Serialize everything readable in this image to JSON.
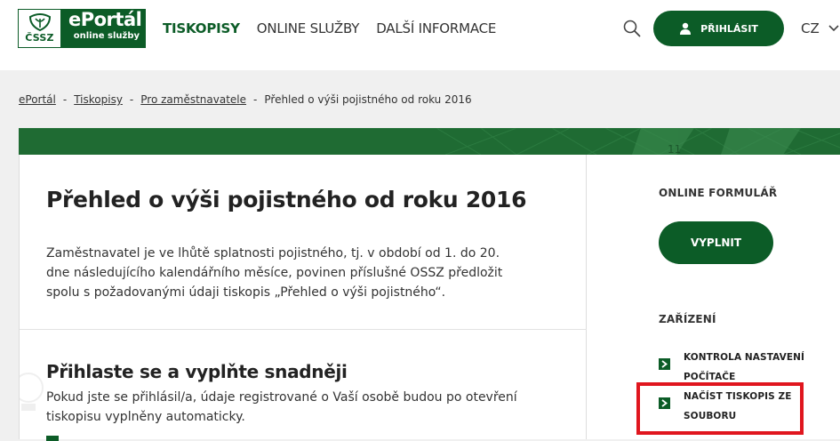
{
  "header": {
    "logo": {
      "cssz": "ČSSZ",
      "portal_name": "ePortál",
      "portal_sub": "online služby"
    },
    "nav": [
      {
        "label": "TISKOPISY",
        "active": true
      },
      {
        "label": "ONLINE SLUŽBY",
        "active": false
      },
      {
        "label": "DALŠÍ INFORMACE",
        "active": false
      }
    ],
    "login_label": "PŘIHLÁSIT",
    "language": "CZ"
  },
  "breadcrumb": [
    "ePortál",
    "Tiskopisy",
    "Pro zaměstnavatele",
    "Přehled o výši pojistného od roku 2016"
  ],
  "main": {
    "title": "Přehled o výši pojistného od roku 2016",
    "intro": "Zaměstnavatel je ve lhůtě splatnosti pojistného, tj. v období od 1. do 20. dne následujícího kalendářního měsíce, povinen příslušné OSSZ předložit spolu s požadovanými údaji tiskopis „Přehled o výši pojistného“.",
    "sub_title": "Přihlaste se a vyplňte snadněji",
    "sub_text": "Pokud jste se přihlásil/a, údaje registrované o Vaší osobě budou po otevření tiskopisu vyplněny automaticky."
  },
  "sidebar": {
    "online_heading": "ONLINE FORMULÁŘ",
    "fill_label": "VYPLNIT",
    "device_heading": "ZAŘÍZENÍ",
    "links": [
      "KONTROLA NASTAVENÍ POČÍTAČE",
      "NAČÍST TISKOPIS ZE SOUBORU"
    ]
  },
  "colors": {
    "brand_green": "#0c5c27",
    "highlight_red": "#e0161e"
  }
}
